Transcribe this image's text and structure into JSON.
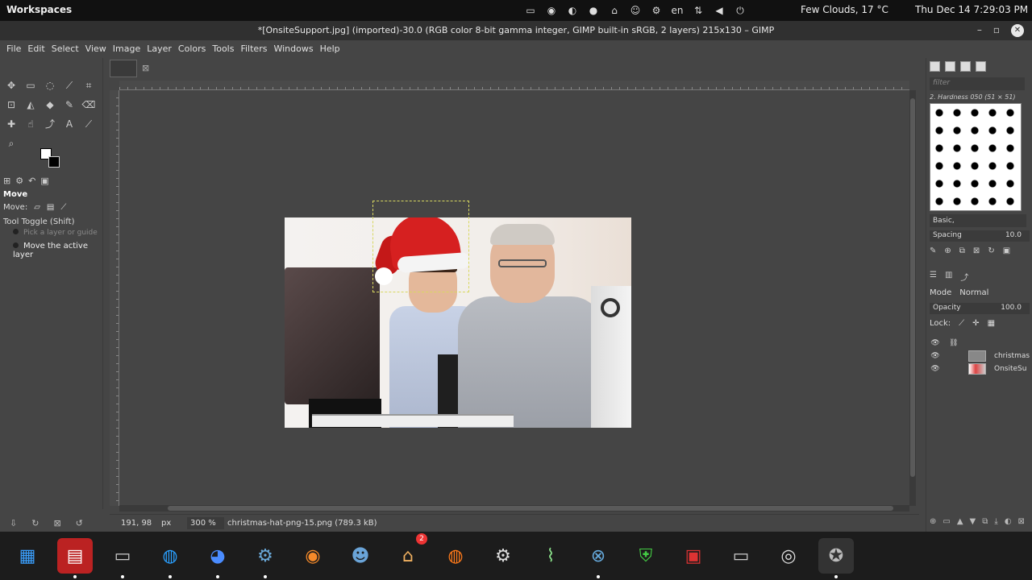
{
  "topbar": {
    "workspaces": "Workspaces",
    "language": "en",
    "weather": "Few Clouds, 17 °C",
    "clock": "Thu Dec 14  7:29:03 PM"
  },
  "window": {
    "title": "*[OnsiteSupport.jpg] (imported)-30.0 (RGB color 8-bit gamma integer, GIMP built-in sRGB, 2 layers) 215x130 – GIMP"
  },
  "menu": [
    "File",
    "Edit",
    "Select",
    "View",
    "Image",
    "Layer",
    "Colors",
    "Tools",
    "Filters",
    "Windows",
    "Help"
  ],
  "tool_options": {
    "title": "Move",
    "move_label": "Move:",
    "toggle_label": "Tool Toggle  (Shift)",
    "option1": "Pick a layer or guide",
    "option2": "Move the active layer"
  },
  "status": {
    "coords": "191, 98",
    "unit": "px",
    "zoom": "300 %",
    "message": "christmas-hat-png-15.png (789.3 kB)"
  },
  "brushes": {
    "filter_placeholder": "filter",
    "current_brush": "2. Hardness 050 (51 × 51)",
    "preset": "Basic,",
    "spacing_label": "Spacing",
    "spacing_value": "10.0"
  },
  "layers": {
    "mode_label": "Mode",
    "mode_value": "Normal",
    "opacity_label": "Opacity",
    "opacity_value": "100.0",
    "lock_label": "Lock:",
    "items": [
      {
        "name": "christmas"
      },
      {
        "name": "OnsiteSu"
      }
    ]
  },
  "taskbar": {
    "badge_count": "2"
  }
}
